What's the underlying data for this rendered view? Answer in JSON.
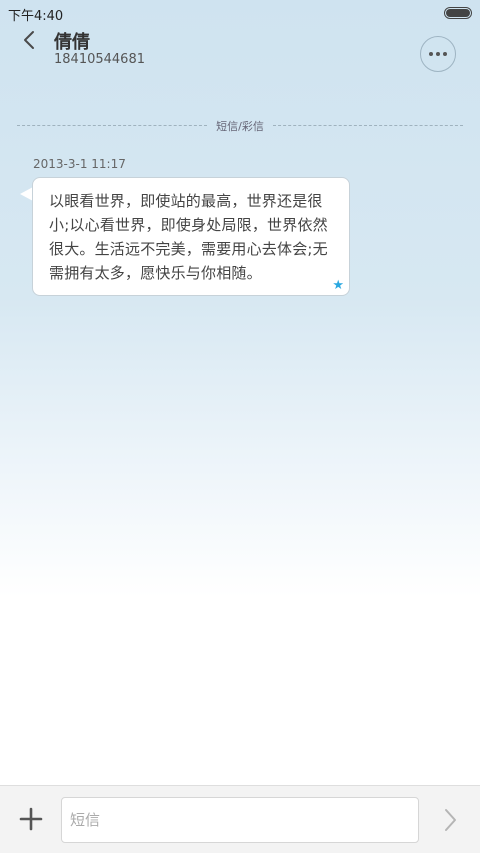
{
  "status_bar": {
    "time": "下午4:40",
    "battery_level": 1.0
  },
  "header": {
    "contact_name": "倩倩",
    "contact_number": "18410544681",
    "back_icon": "chevron-left-icon",
    "more_icon": "more-dots-icon"
  },
  "thread": {
    "divider_label": "短信/彩信",
    "messages": [
      {
        "timestamp": "2013-3-1 11:17",
        "lines": [
          "以眼看世界，即使站的最高，世界还是很",
          "小;以心看世界，即使身处局限，世界依然",
          "很大。生活远不完美，需要用心去体会;无",
          "需拥有太多，愿快乐与你相随。"
        ],
        "starred": true,
        "star_color": "#2aa8e0"
      }
    ]
  },
  "composer": {
    "add_icon": "plus-icon",
    "placeholder": "短信",
    "value": "",
    "send_icon": "chevron-right-icon"
  }
}
